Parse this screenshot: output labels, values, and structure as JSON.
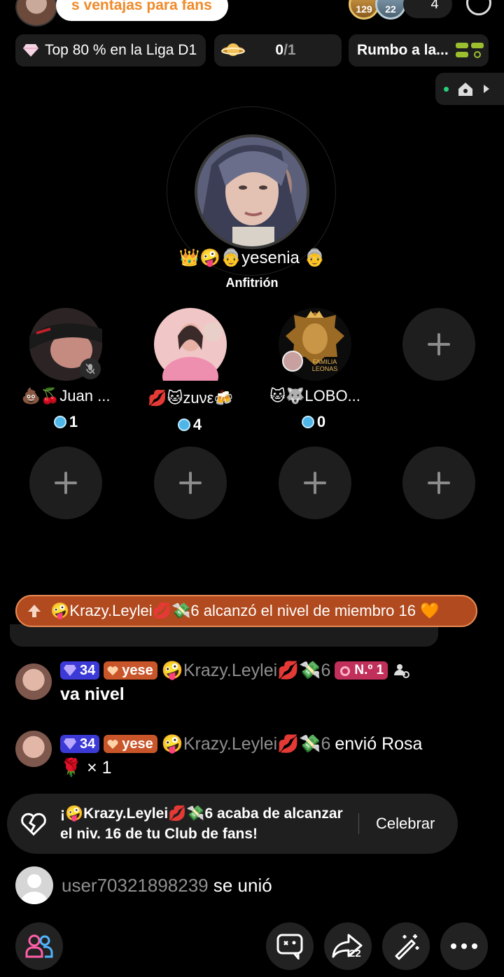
{
  "top": {
    "promo_text": "s ventajas para fans",
    "viewer_a_badge": "129",
    "viewer_b_badge": "22",
    "viewer_count": "4"
  },
  "chips": {
    "league_text": "Top 80 % en la Liga D1",
    "progress_value": "0",
    "progress_total": "/1",
    "goal_text": "Rumbo a la..."
  },
  "host": {
    "name": "👑🤪👵yesenia 👵",
    "role": "Anfitrión"
  },
  "seats": [
    {
      "name": "💩🍒Juan ...",
      "score": "1"
    },
    {
      "name": "💋🐱zuνε🍻",
      "score": "4"
    },
    {
      "name": "🐱🐺LOBO...",
      "score": "0"
    }
  ],
  "seat_logo_text": "FAMILIA\nLEONAS",
  "banner": {
    "text": "🤪Krazy.Leylei💋💸6 alcanzó el nivel de miembro 16 🧡"
  },
  "chat": [
    {
      "level": "34",
      "fan_badge": "yese",
      "user": "🤪Krazy.Leylei💋💸6",
      "rank": "N.º 1",
      "message": "va nivel"
    },
    {
      "level": "34",
      "fan_badge": "yese",
      "user": "🤪Krazy.Leylei💋💸6",
      "message": "envió Rosa",
      "gift": "🌹 × 1"
    }
  ],
  "fan_notice": {
    "text": "¡🤪Krazy.Leylei💋💸6 acaba de alcanzar el niv. 16 de tu Club de fans!",
    "action": "Celebrar"
  },
  "join": {
    "user": "user70321898239",
    "action": "se unió"
  },
  "bottom": {
    "share_count": "22"
  },
  "colors": {
    "banner": "#b14a1e",
    "level_badge": "#3c3ad6",
    "fan_badge": "#c8562a",
    "rank_badge": "#c0305a",
    "accent_pink": "#ff5fa8"
  }
}
